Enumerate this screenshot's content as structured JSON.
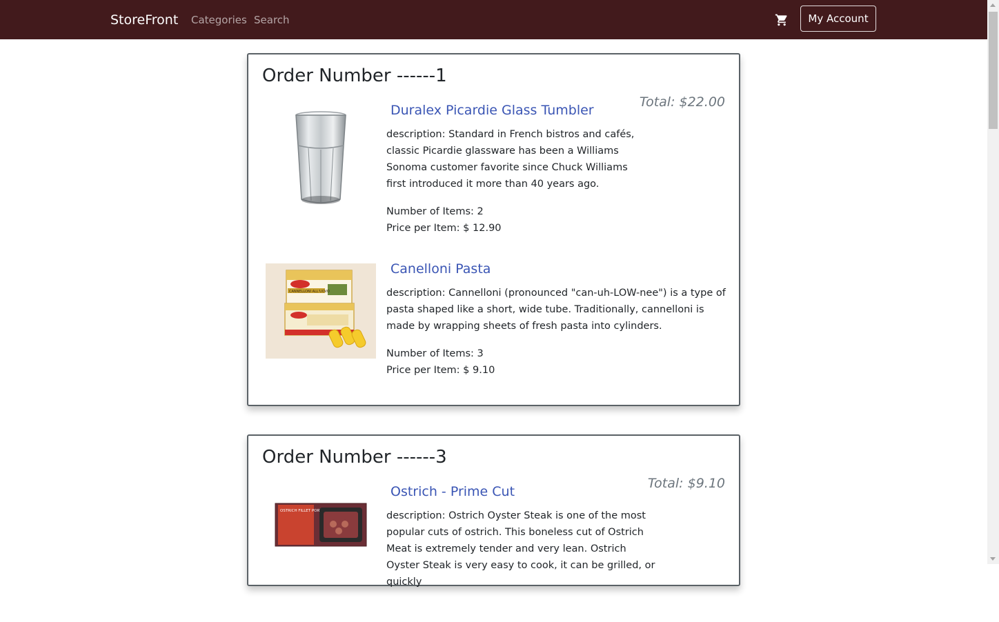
{
  "navbar": {
    "brand": "StoreFront",
    "links": [
      "Categories",
      "Search"
    ],
    "account_label": "My Account"
  },
  "orders": [
    {
      "title": "Order Number ------1",
      "total": "Total: $22.00",
      "items": [
        {
          "name": "Duralex Picardie Glass Tumbler",
          "description": "description: Standard in French bistros and cafés, classic Picardie glassware has been a Williams Sonoma customer favorite since Chuck Williams first introduced it more than 40 years ago.",
          "quantity": "Number of Items: 2",
          "price": "Price per Item: $ 12.90"
        },
        {
          "name": "Canelloni Pasta",
          "description": "description: Cannelloni (pronounced \"can-uh-LOW-nee\") is a type of pasta shaped like a short, wide tube. Traditionally, cannelloni is made by wrapping sheets of fresh pasta into cylinders.",
          "quantity": "Number of Items: 3",
          "price": "Price per Item: $ 9.10"
        }
      ]
    },
    {
      "title": "Order Number ------3",
      "total": "Total: $9.10",
      "items": [
        {
          "name": "Ostrich - Prime Cut",
          "description": "description: Ostrich Oyster Steak is one of the most popular cuts of ostrich. This boneless cut of Ostrich Meat is extremely tender and very lean. Ostrich Oyster Steak is very easy to cook, it can be grilled, or quickly"
        }
      ]
    }
  ],
  "images": {
    "ostrich_package_text": "OSTRICH FILLET PORTIONS",
    "pasta_package_text": "CANNELLONI ALL'UOVO"
  },
  "colors": {
    "navbar_bg": "#421a1c",
    "link": "#3a55b4",
    "total": "#6c757d"
  }
}
